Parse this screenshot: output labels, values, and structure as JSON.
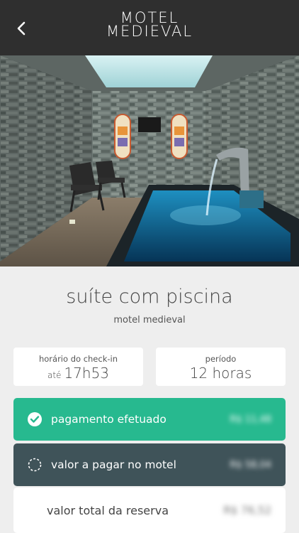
{
  "header": {
    "back_icon": "chevron-left-icon",
    "logo_line1": "MOTEL",
    "logo_line2": "MEDIEVAL"
  },
  "suite": {
    "title": "suíte com piscina",
    "motel": "motel medieval"
  },
  "checkin": {
    "label": "horário do check-in",
    "prefix": "até",
    "time": "17h53"
  },
  "period": {
    "label": "período",
    "value": "12 horas"
  },
  "payments": {
    "paid_label": "pagamento efetuado",
    "paid_amount": "R$ 11,48",
    "due_label": "valor a pagar no motel",
    "due_amount": "R$ 58,04",
    "total_label": "valor total da reserva",
    "total_amount": "R$ 76,52"
  },
  "colors": {
    "paid_bg": "#27b98f",
    "due_bg": "#3f5359",
    "header_bg": "#2f2f2f"
  }
}
